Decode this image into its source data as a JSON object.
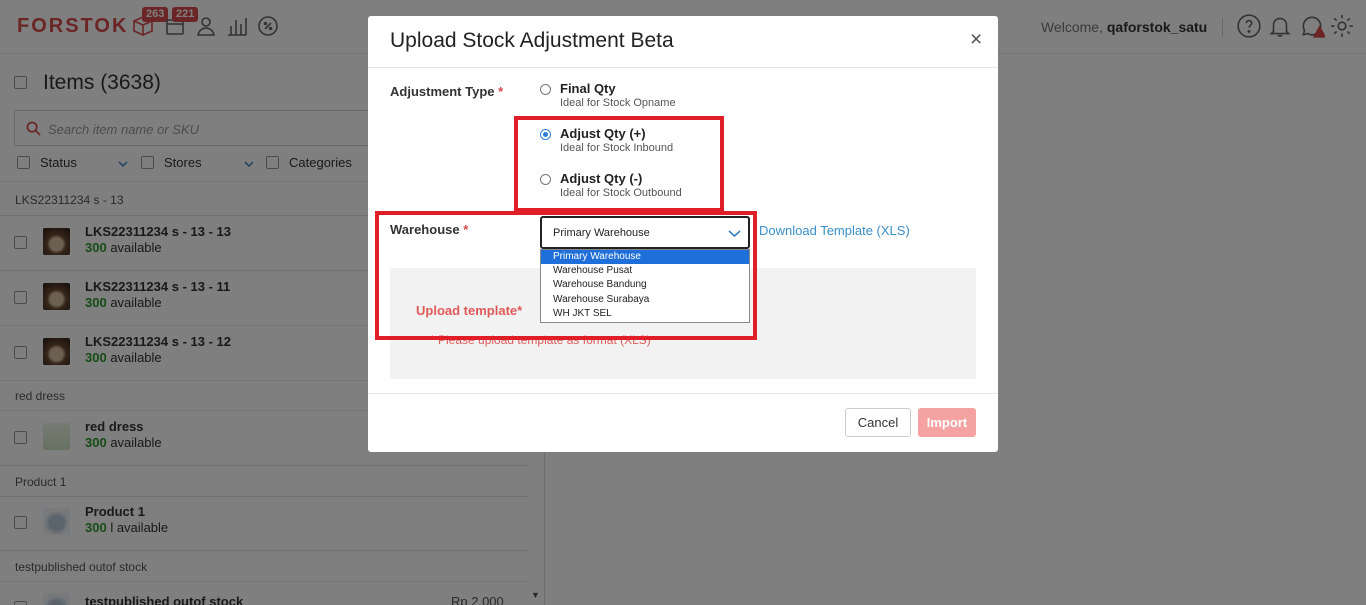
{
  "brand": {
    "logo": "FORSTOK",
    "accent_color": "#d64a4a"
  },
  "nav": {
    "icons": [
      "box-icon",
      "package-icon",
      "user-icon",
      "chart-icon",
      "discount-icon"
    ],
    "badge_box": "263",
    "badge_package": "221",
    "welcome_prefix": "Welcome,",
    "username": "qaforstok_satu",
    "right_icons": [
      "help-icon",
      "bell-icon",
      "chat-alert-icon",
      "gear-icon"
    ]
  },
  "left": {
    "title": "Items",
    "count": "(3638)",
    "search_placeholder": "Search item name or SKU",
    "filters": [
      "Status",
      "Stores",
      "Categories"
    ],
    "groups": [
      {
        "label": "LKS22311234 s - 13",
        "items": [
          {
            "name": "LKS22311234 s - 13 - 13",
            "qty": "300",
            "suffix": "available"
          },
          {
            "name": "LKS22311234 s - 13 - 11",
            "qty": "300",
            "suffix": "available"
          },
          {
            "name": "LKS22311234 s - 13 - 12",
            "qty": "300",
            "suffix": "available"
          }
        ]
      },
      {
        "label": "red dress",
        "items": [
          {
            "name": "red dress",
            "qty": "300",
            "suffix": "available"
          }
        ]
      },
      {
        "label": "Product 1",
        "items": [
          {
            "name": "Product 1",
            "qty": "300",
            "suffix": "l available"
          }
        ]
      },
      {
        "label": "testpublished outof stock",
        "items": [
          {
            "name": "testpublished outof stock",
            "price": "Rp 2.000"
          }
        ]
      }
    ]
  },
  "modal": {
    "title": "Upload Stock Adjustment Beta",
    "close": "×",
    "adjustment_label": "Adjustment Type",
    "required_mark": "*",
    "options": [
      {
        "title": "Final Qty",
        "desc": "Ideal for Stock Opname",
        "checked": false
      },
      {
        "title": "Adjust Qty (+)",
        "desc": "Ideal for Stock Inbound",
        "checked": true
      },
      {
        "title": "Adjust Qty (-)",
        "desc": "Ideal for Stock Outbound",
        "checked": false
      }
    ],
    "warehouse_label": "Warehouse",
    "warehouse_selected": "Primary Warehouse",
    "warehouse_options": [
      "Primary Warehouse",
      "Warehouse Pusat",
      "Warehouse Bandung",
      "Warehouse Surabaya",
      "WH JKT SEL"
    ],
    "download_link": "Download Template (XLS)",
    "upload_label": "Upload template",
    "upload_required": "*",
    "upload_hint": "* Please upload template as format (XLS)",
    "cancel": "Cancel",
    "import": "Import",
    "highlight_color": "#e01e27"
  }
}
